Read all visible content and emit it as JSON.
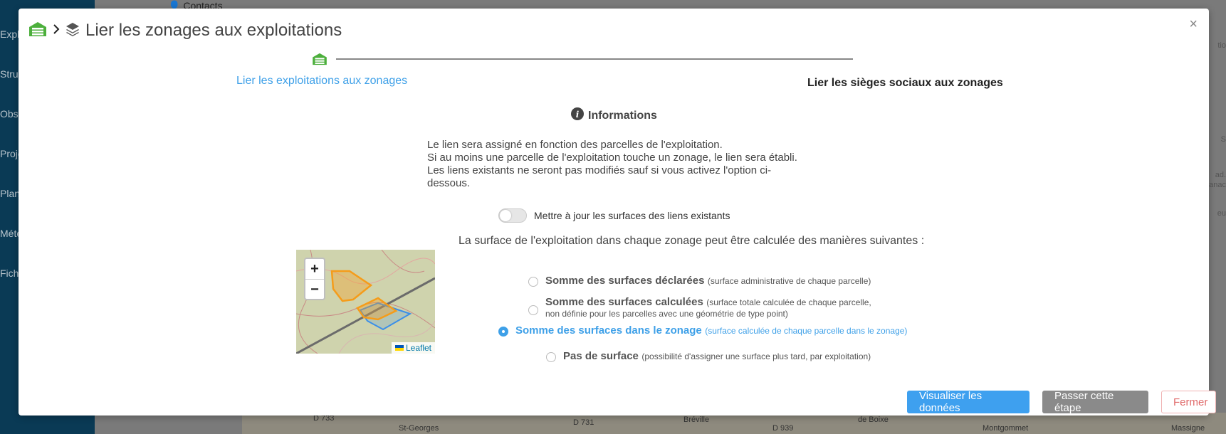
{
  "background": {
    "sidebar_items": [
      "Explo",
      "Structu",
      "Obse",
      "Proje",
      "Plans",
      "Météo",
      "Fichie"
    ],
    "topnav_contacts": "Contacts",
    "map_labels": [
      "D 733",
      "St-Georges",
      "D 731",
      "Bréville",
      "de Boixe",
      "D 939",
      "Montgommet",
      "Massigne"
    ],
    "right_labels": [
      "tio",
      "S",
      "ad.",
      "anac",
      "eu"
    ]
  },
  "modal": {
    "title": "Lier les zonages aux exploitations",
    "close_label": "×",
    "steps": [
      {
        "label": "Lier les exploitations aux zonages",
        "active": true
      },
      {
        "label": "Lier les sièges sociaux aux zonages",
        "active": false
      }
    ],
    "info": {
      "title": "Informations",
      "lines": [
        "Le lien sera assigné en fonction des parcelles de l'exploitation.",
        "Si au moins une parcelle de l'exploitation touche un zonage, le lien sera établi.",
        "Les liens existants ne seront pas modifiés sauf si vous activez l'option ci-dessous."
      ]
    },
    "toggle": {
      "label": "Mettre à jour les surfaces des liens existants",
      "on": false
    },
    "surface_intro": "La surface de l'exploitation dans chaque zonage peut être calculée des manières suivantes :",
    "map": {
      "zoom_in": "+",
      "zoom_out": "−",
      "attribution": "Leaflet"
    },
    "options": [
      {
        "title": "Somme des surfaces déclarées",
        "sub": "(surface administrative de chaque parcelle)",
        "checked": false
      },
      {
        "title": "Somme des surfaces calculées",
        "sub": "(surface totale calculée de chaque parcelle,",
        "sub2": "non définie pour les parcelles avec une géométrie de type point)",
        "checked": false
      },
      {
        "title": "Somme des surfaces dans le zonage",
        "sub": "(surface calculée de chaque parcelle dans le zonage)",
        "checked": true
      },
      {
        "title": "Pas de surface",
        "sub": "(possibilité d'assigner une surface plus tard, par exploitation)",
        "checked": false
      }
    ],
    "buttons": {
      "visualize": "Visualiser les données",
      "skip": "Passer cette étape",
      "close": "Fermer"
    }
  },
  "colors": {
    "accent": "#3ea0e8",
    "green_icon": "#4caf3c",
    "secondary_btn": "#8a8a8a",
    "danger_text": "#e06a6a",
    "orange_zone": "#f59c1a",
    "blue_zone": "#3b8fe8"
  }
}
